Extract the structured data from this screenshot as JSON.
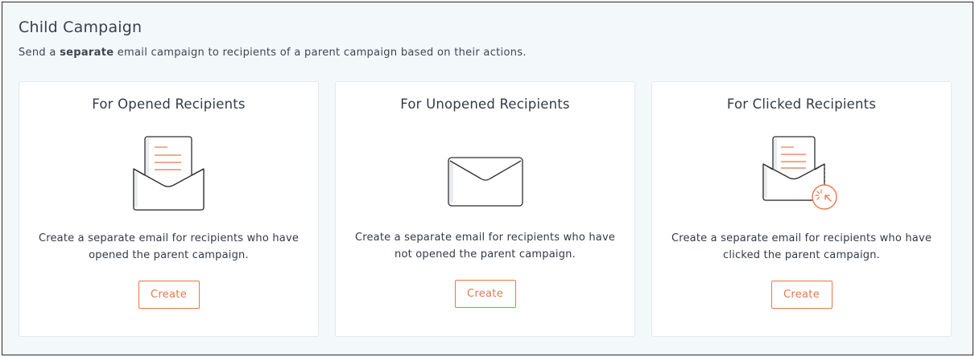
{
  "page": {
    "title": "Child Campaign",
    "subtitle_prefix": "Send a ",
    "subtitle_bold": "separate",
    "subtitle_suffix": " email campaign to recipients of a parent campaign based on their actions."
  },
  "cards": [
    {
      "title": "For Opened Recipients",
      "icon": "open-envelope-icon",
      "desc_line1": "Create a separate email for recipients who have",
      "desc_line2": "opened the parent campaign.",
      "button_label": "Create"
    },
    {
      "title": "For Unopened Recipients",
      "icon": "closed-envelope-icon",
      "desc_line1": "Create a separate email for recipients who have",
      "desc_line2": "not opened the parent campaign.",
      "button_label": "Create"
    },
    {
      "title": "For Clicked Recipients",
      "icon": "clicked-envelope-icon",
      "desc_line1": "Create a separate email for recipients who have",
      "desc_line2": "clicked the parent campaign.",
      "button_label": "Create"
    }
  ],
  "colors": {
    "accent": "#e8774a",
    "background": "#f3f8fb",
    "card": "#ffffff",
    "text": "#333b47"
  }
}
